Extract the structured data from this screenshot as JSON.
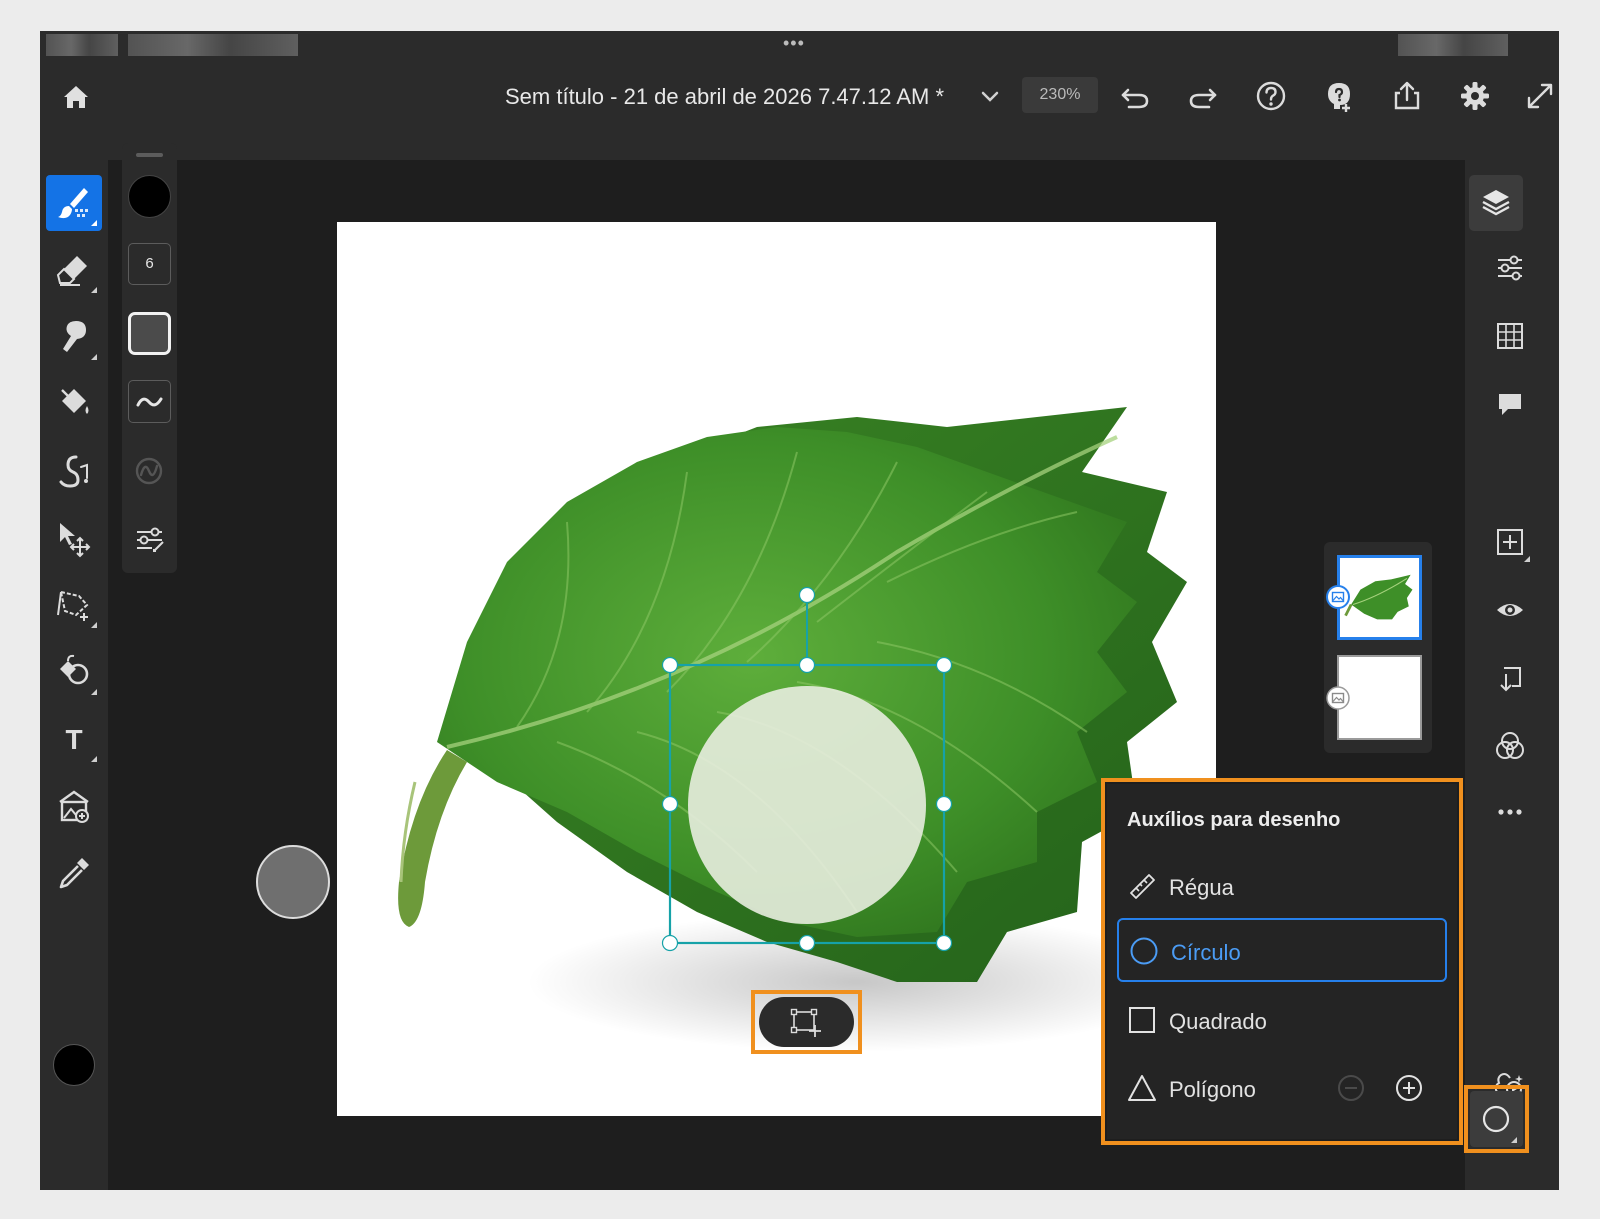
{
  "status_bar": {
    "drag_handle": "•••"
  },
  "header": {
    "document_title": "Sem título - 21 de abril de 2026 7.47.12 AM *",
    "zoom_level": "230%",
    "icons": [
      "home-icon",
      "chevron-down-icon",
      "undo-icon",
      "redo-icon",
      "help-icon",
      "learn-icon",
      "share-icon",
      "settings-icon",
      "fullscreen-icon"
    ]
  },
  "left_toolbar": {
    "tools": [
      "brush-tool",
      "eraser-tool",
      "smudge-tool",
      "fill-tool",
      "healing-tool",
      "move-tool",
      "lasso-tool",
      "clone-tool",
      "type-tool",
      "place-image-tool",
      "eyedropper-tool"
    ],
    "active_tool": "brush-tool",
    "type_tool_glyph": "T",
    "primary_color": "#000000"
  },
  "brush_panel": {
    "color": "#000000",
    "size": "6",
    "icons": [
      "brush-opacity-swatch",
      "smoothing-icon",
      "pressure-icon",
      "brush-settings-icon"
    ]
  },
  "layers": {
    "items": [
      {
        "name": "leaf-layer",
        "selected": true
      },
      {
        "name": "background-layer",
        "selected": false
      }
    ]
  },
  "right_toolbar": {
    "icons": [
      "layers-icon",
      "adjustments-icon",
      "grid-icon",
      "comments-icon",
      "add-layer-icon",
      "visibility-icon",
      "download-icon",
      "blend-icon",
      "more-icon",
      "generative-icon",
      "drawing-aids-icon"
    ]
  },
  "drawing_aids": {
    "title": "Auxílios para desenho",
    "items": [
      {
        "id": "ruler",
        "label": "Régua",
        "icon": "ruler-icon",
        "selected": false
      },
      {
        "id": "circle",
        "label": "Círculo",
        "icon": "circle-icon",
        "selected": true
      },
      {
        "id": "square",
        "label": "Quadrado",
        "icon": "square-icon",
        "selected": false
      },
      {
        "id": "polygon",
        "label": "Polígono",
        "icon": "triangle-icon",
        "selected": false
      }
    ],
    "polygon_controls": [
      "minus-circle-icon",
      "plus-circle-icon"
    ]
  },
  "colors": {
    "accent": "#2680eb",
    "highlight": "#f0901e",
    "panel": "#2b2b2b",
    "workspace": "#1e1e1e",
    "selection": "#16a2a8"
  }
}
